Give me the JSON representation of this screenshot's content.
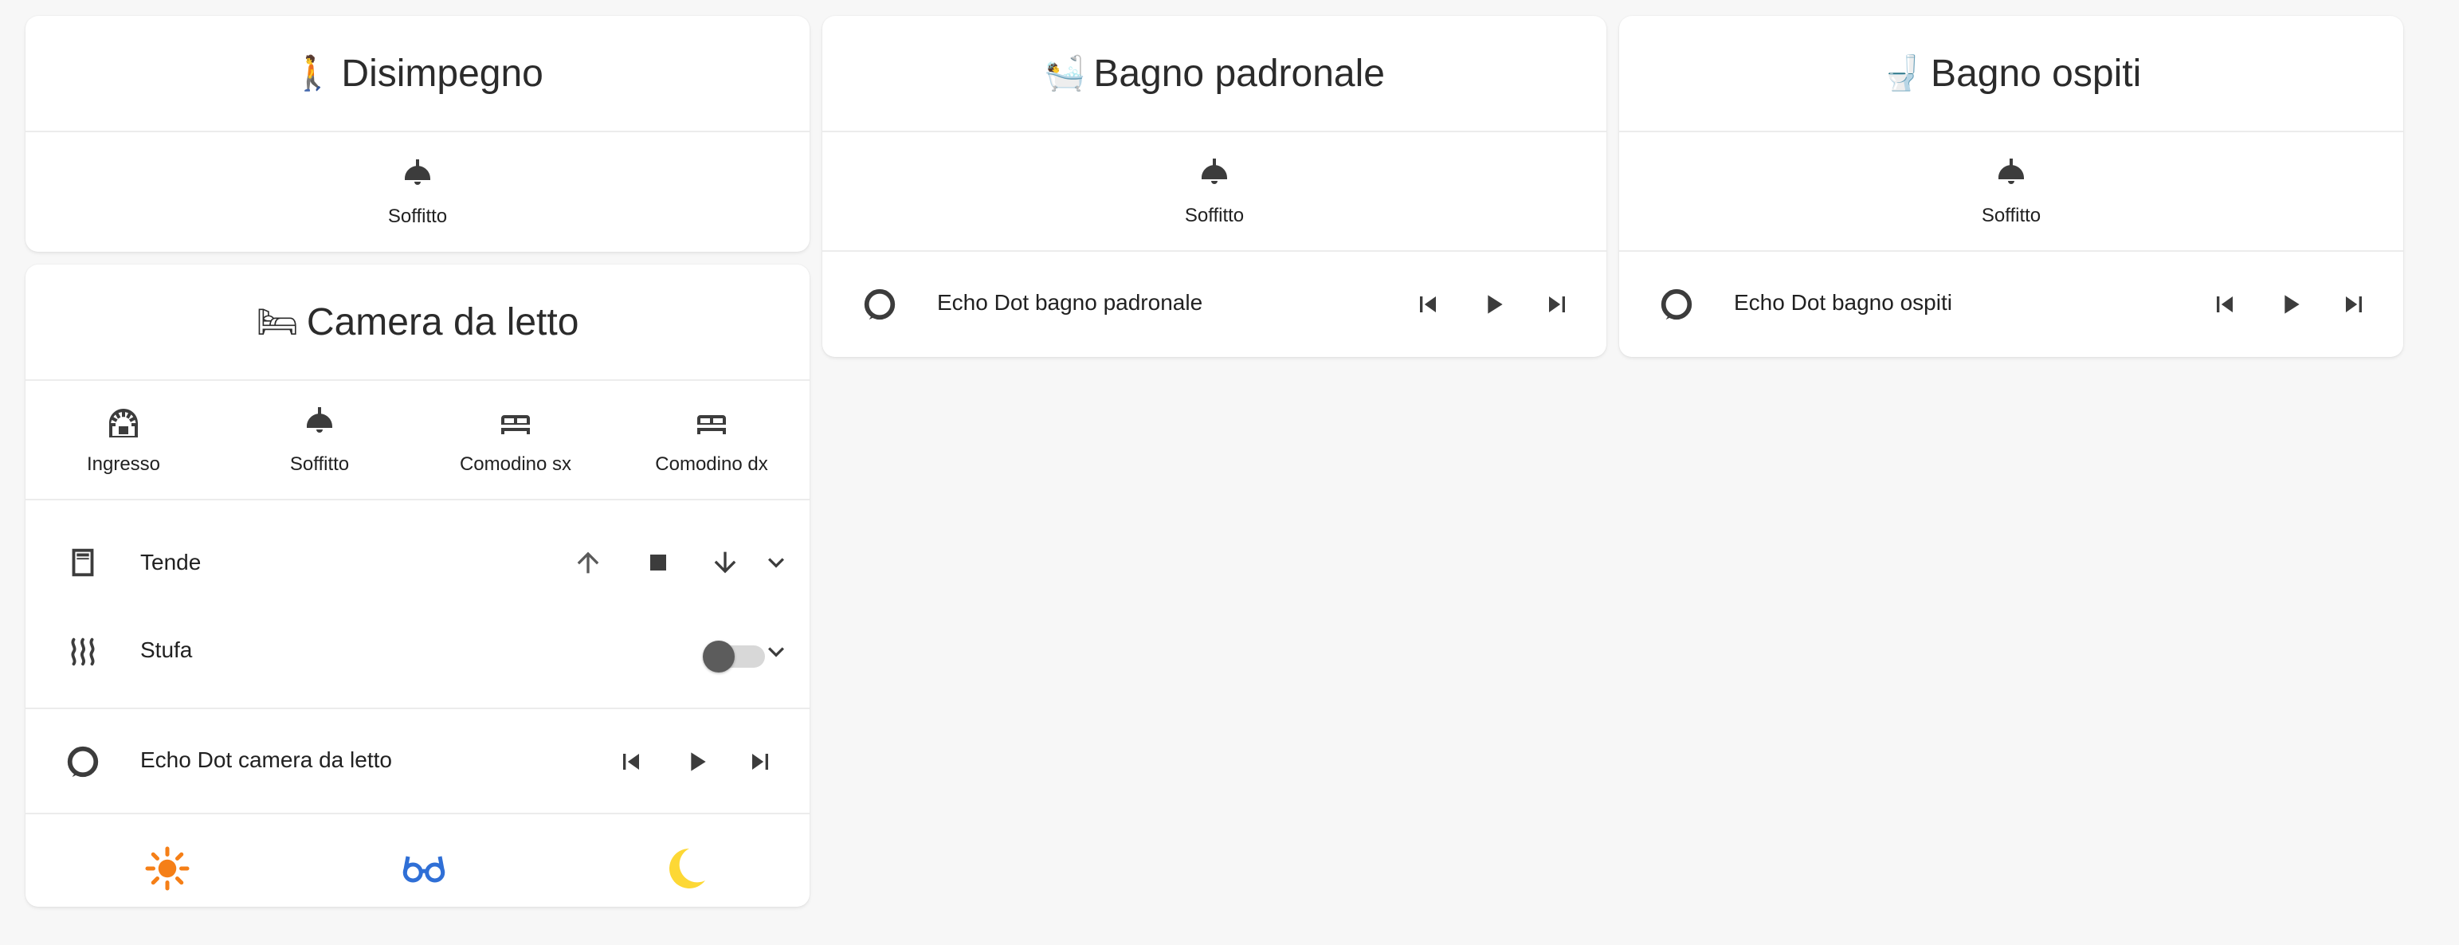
{
  "cards": {
    "disimpegno": {
      "emoji": "🚶",
      "title": "Disimpegno",
      "glance": [
        {
          "label": "Soffitto",
          "icon": "ceiling-light-icon"
        }
      ]
    },
    "bagno_padronale": {
      "emoji": "🛀",
      "title": "Bagno padronale",
      "glance": [
        {
          "label": "Soffitto",
          "icon": "ceiling-light-icon"
        }
      ],
      "media": {
        "label": "Echo Dot bagno padronale",
        "icon": "amazon-alexa-icon"
      }
    },
    "bagno_ospiti": {
      "emoji": "🚽",
      "title": "Bagno ospiti",
      "glance": [
        {
          "label": "Soffitto",
          "icon": "ceiling-light-icon"
        }
      ],
      "media": {
        "label": "Echo Dot bagno ospiti",
        "icon": "amazon-alexa-icon"
      }
    },
    "camera": {
      "emoji": "🛏",
      "title": "Camera da letto",
      "glance": [
        {
          "label": "Ingresso",
          "icon": "arch-light-icon"
        },
        {
          "label": "Soffitto",
          "icon": "ceiling-light-icon"
        },
        {
          "label": "Comodino sx",
          "icon": "bed-icon"
        },
        {
          "label": "Comodino dx",
          "icon": "bed-icon"
        }
      ],
      "cover": {
        "label": "Tende",
        "icon": "curtains-icon"
      },
      "heater": {
        "label": "Stufa",
        "icon": "radiator-icon",
        "state": "off"
      },
      "media": {
        "label": "Echo Dot camera da letto",
        "icon": "amazon-alexa-icon"
      },
      "scenes": [
        {
          "icon": "sun-icon",
          "color": "#f57f17"
        },
        {
          "icon": "glasses-icon",
          "color": "#2f6fd6"
        },
        {
          "icon": "moon-icon",
          "color": "#fdd835"
        }
      ]
    }
  },
  "colors": {
    "icon": "#3c3c3c",
    "toggle_off_track": "#d8d8d8",
    "toggle_off_knob": "#5c5c5c"
  }
}
